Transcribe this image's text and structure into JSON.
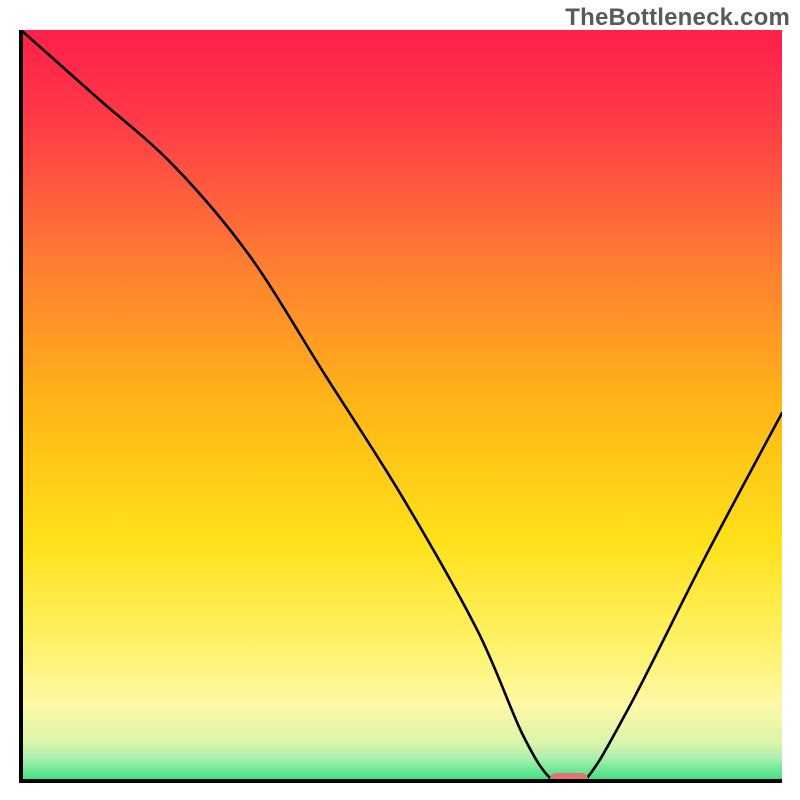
{
  "watermark": "TheBottleneck.com",
  "colors": {
    "gradient_top": "#ff1f4b",
    "gradient_bottom": "#39e07f",
    "curve": "#000000",
    "axis": "#000000",
    "marker": "#e4736f"
  },
  "chart_data": {
    "type": "line",
    "title": "",
    "xlabel": "",
    "ylabel": "",
    "xlim": [
      0,
      100
    ],
    "ylim": [
      0,
      100
    ],
    "x": [
      0,
      10,
      20,
      30,
      40,
      50,
      60,
      66,
      70,
      74,
      80,
      90,
      100
    ],
    "values": [
      100,
      91,
      82,
      70,
      54,
      38,
      20,
      6,
      0,
      0,
      10,
      30,
      49
    ],
    "marker": {
      "x": 72,
      "y": 0,
      "width_x": 5,
      "height_y": 2
    },
    "background_gradient": [
      {
        "pos": 0.0,
        "color": "#ff1f4b"
      },
      {
        "pos": 0.12,
        "color": "#ff3a47"
      },
      {
        "pos": 0.3,
        "color": "#ff7a34"
      },
      {
        "pos": 0.5,
        "color": "#ffb617"
      },
      {
        "pos": 0.68,
        "color": "#ffe11a"
      },
      {
        "pos": 0.82,
        "color": "#fff26a"
      },
      {
        "pos": 0.9,
        "color": "#fdf9a8"
      },
      {
        "pos": 0.95,
        "color": "#d9f5aa"
      },
      {
        "pos": 0.97,
        "color": "#a8efb0"
      },
      {
        "pos": 1.0,
        "color": "#39e07f"
      }
    ]
  }
}
